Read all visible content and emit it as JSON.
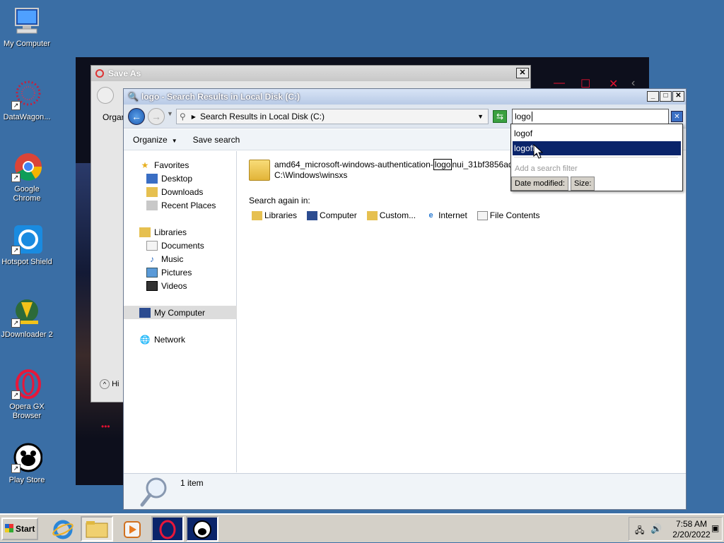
{
  "desktop": {
    "icons": [
      {
        "label": "My Computer",
        "icon": "my-computer-icon"
      },
      {
        "label": "DataWagon...",
        "icon": "datawagon-icon"
      },
      {
        "label": "Google Chrome",
        "icon": "chrome-icon"
      },
      {
        "label": "Hotspot Shield",
        "icon": "hotspot-shield-icon"
      },
      {
        "label": "JDownloader 2",
        "icon": "jdownloader-icon"
      },
      {
        "label": "Opera GX Browser",
        "icon": "opera-gx-icon"
      },
      {
        "label": "Play Store",
        "icon": "play-store-icon"
      }
    ]
  },
  "background_dialog": {
    "title": "Save As",
    "organize_partial": "Orgar",
    "hide_partial": "Hi"
  },
  "explorer": {
    "title": "logo - Search Results in Local Disk (C:)",
    "address": "Search Results in Local Disk (C:)",
    "search_value": "logo",
    "toolbar": {
      "organize": "Organize",
      "save_search": "Save search"
    },
    "nav": {
      "favorites": "Favorites",
      "desktop": "Desktop",
      "downloads": "Downloads",
      "recent": "Recent Places",
      "libraries": "Libraries",
      "documents": "Documents",
      "music": "Music",
      "pictures": "Pictures",
      "videos": "Videos",
      "my_computer": "My Computer",
      "network": "Network"
    },
    "result": {
      "name_before": "amd64_microsoft-windows-authentication-",
      "name_match": "logo",
      "name_after": "nui_31bf3856ad364...",
      "path": "C:\\Windows\\winsxs"
    },
    "search_again": {
      "label": "Search again in:",
      "options": [
        "Libraries",
        "Computer",
        "Custom...",
        "Internet",
        "File Contents"
      ]
    },
    "status": {
      "count": "1 item"
    }
  },
  "suggestions": {
    "items": [
      "logof",
      "logoff"
    ],
    "selected_index": 1,
    "filter_hint": "Add a search filter",
    "filters": [
      "Date modified:",
      "Size:"
    ]
  },
  "taskbar": {
    "start": "Start",
    "time": "7:58 AM",
    "date": "2/20/2022"
  },
  "colors": {
    "desktop": "#3a6ea5",
    "selection": "#0a246a",
    "title_gradient": "#b8cae6"
  }
}
